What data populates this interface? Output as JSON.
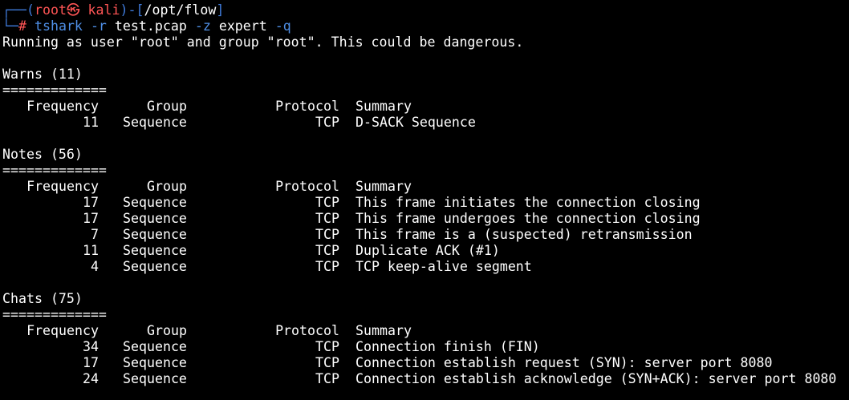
{
  "prompt": {
    "box_top": "┌──(",
    "user": "root",
    "at_symbol": "㉿",
    "host": "kali",
    "box_mid": ")-[",
    "path": "/opt/flow",
    "box_end": "]",
    "box_bottom": "└─",
    "hash": "#",
    "command": "tshark",
    "opt_r": "-r",
    "file": "test.pcap",
    "opt_z": "-z",
    "stat": "expert",
    "opt_q": "-q"
  },
  "warning_line": "Running as user \"root\" and group \"root\". This could be dangerous.",
  "columns": {
    "frequency": "Frequency",
    "group": "Group",
    "protocol": "Protocol",
    "summary": "Summary"
  },
  "separator": "=============",
  "sections": [
    {
      "title": "Warns (11)",
      "rows": [
        {
          "frequency": "11",
          "group": "Sequence",
          "protocol": "TCP",
          "summary": "D-SACK Sequence"
        }
      ]
    },
    {
      "title": "Notes (56)",
      "rows": [
        {
          "frequency": "17",
          "group": "Sequence",
          "protocol": "TCP",
          "summary": "This frame initiates the connection closing"
        },
        {
          "frequency": "17",
          "group": "Sequence",
          "protocol": "TCP",
          "summary": "This frame undergoes the connection closing"
        },
        {
          "frequency": "7",
          "group": "Sequence",
          "protocol": "TCP",
          "summary": "This frame is a (suspected) retransmission"
        },
        {
          "frequency": "11",
          "group": "Sequence",
          "protocol": "TCP",
          "summary": "Duplicate ACK (#1)"
        },
        {
          "frequency": "4",
          "group": "Sequence",
          "protocol": "TCP",
          "summary": "TCP keep-alive segment"
        }
      ]
    },
    {
      "title": "Chats (75)",
      "rows": [
        {
          "frequency": "34",
          "group": "Sequence",
          "protocol": "TCP",
          "summary": "Connection finish (FIN)"
        },
        {
          "frequency": "17",
          "group": "Sequence",
          "protocol": "TCP",
          "summary": "Connection establish request (SYN): server port 8080"
        },
        {
          "frequency": "24",
          "group": "Sequence",
          "protocol": "TCP",
          "summary": "Connection establish acknowledge (SYN+ACK): server port 8080"
        }
      ]
    }
  ],
  "colors": {
    "background": "#000000",
    "text": "#ffffff",
    "prompt_frame": "#3f7ad9",
    "prompt_user": "#ff5555",
    "command": "#4f8fe6"
  }
}
